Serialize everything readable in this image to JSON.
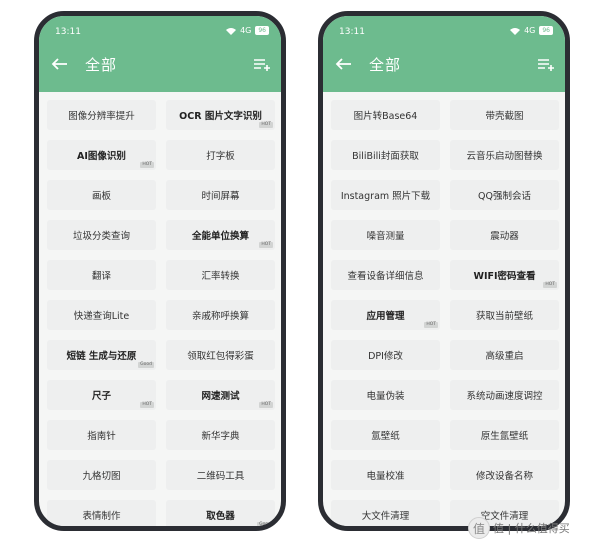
{
  "left": {
    "status": {
      "time": "13:11",
      "network": "4G",
      "battery": "96"
    },
    "title": "全部",
    "tiles": [
      {
        "label": "图像分辨率提升",
        "bold": false,
        "tag": ""
      },
      {
        "label": "OCR 图片文字识别",
        "bold": true,
        "tag": "HOT"
      },
      {
        "label": "AI图像识别",
        "bold": true,
        "tag": "HOT"
      },
      {
        "label": "打字板",
        "bold": false,
        "tag": ""
      },
      {
        "label": "画板",
        "bold": false,
        "tag": ""
      },
      {
        "label": "时间屏幕",
        "bold": false,
        "tag": ""
      },
      {
        "label": "垃圾分类查询",
        "bold": false,
        "tag": ""
      },
      {
        "label": "全能单位换算",
        "bold": true,
        "tag": "HOT"
      },
      {
        "label": "翻译",
        "bold": false,
        "tag": ""
      },
      {
        "label": "汇率转换",
        "bold": false,
        "tag": ""
      },
      {
        "label": "快递查询Lite",
        "bold": false,
        "tag": ""
      },
      {
        "label": "亲戚称呼换算",
        "bold": false,
        "tag": ""
      },
      {
        "label": "短链 生成与还原",
        "bold": true,
        "tag": "Good"
      },
      {
        "label": "领取红包得彩蛋",
        "bold": false,
        "tag": ""
      },
      {
        "label": "尺子",
        "bold": true,
        "tag": "HOT"
      },
      {
        "label": "网速测试",
        "bold": true,
        "tag": "HOT"
      },
      {
        "label": "指南针",
        "bold": false,
        "tag": ""
      },
      {
        "label": "新华字典",
        "bold": false,
        "tag": ""
      },
      {
        "label": "九格切图",
        "bold": false,
        "tag": ""
      },
      {
        "label": "二维码工具",
        "bold": false,
        "tag": ""
      },
      {
        "label": "表情制作",
        "bold": false,
        "tag": ""
      },
      {
        "label": "取色器",
        "bold": true,
        "tag": "Good"
      }
    ]
  },
  "right": {
    "status": {
      "time": "13:11",
      "network": "4G",
      "battery": "96"
    },
    "title": "全部",
    "tiles": [
      {
        "label": "图片转Base64",
        "bold": false,
        "tag": ""
      },
      {
        "label": "带壳截图",
        "bold": false,
        "tag": ""
      },
      {
        "label": "BiliBili封面获取",
        "bold": false,
        "tag": ""
      },
      {
        "label": "云音乐启动图替换",
        "bold": false,
        "tag": ""
      },
      {
        "label": "Instagram 照片下载",
        "bold": false,
        "tag": ""
      },
      {
        "label": "QQ强制会话",
        "bold": false,
        "tag": ""
      },
      {
        "label": "噪音测量",
        "bold": false,
        "tag": ""
      },
      {
        "label": "震动器",
        "bold": false,
        "tag": ""
      },
      {
        "label": "查看设备详细信息",
        "bold": false,
        "tag": ""
      },
      {
        "label": "WIFI密码查看",
        "bold": true,
        "tag": "HOT"
      },
      {
        "label": "应用管理",
        "bold": true,
        "tag": "HOT"
      },
      {
        "label": "获取当前壁纸",
        "bold": false,
        "tag": ""
      },
      {
        "label": "DPI修改",
        "bold": false,
        "tag": ""
      },
      {
        "label": "高级重启",
        "bold": false,
        "tag": ""
      },
      {
        "label": "电量伪装",
        "bold": false,
        "tag": ""
      },
      {
        "label": "系统动画速度调控",
        "bold": false,
        "tag": ""
      },
      {
        "label": "氲壁纸",
        "bold": false,
        "tag": ""
      },
      {
        "label": "原生氲壁纸",
        "bold": false,
        "tag": ""
      },
      {
        "label": "电量校准",
        "bold": false,
        "tag": ""
      },
      {
        "label": "修改设备名称",
        "bold": false,
        "tag": ""
      },
      {
        "label": "大文件清理",
        "bold": false,
        "tag": ""
      },
      {
        "label": "空文件清理",
        "bold": false,
        "tag": ""
      }
    ]
  },
  "watermark": "值 | 什么值得买",
  "colors": {
    "header": "#6dbb8e",
    "tile": "#eeefef",
    "frame": "#2b2d33"
  },
  "icons": {
    "back": "arrow-left-icon",
    "menu": "playlist-add-icon"
  }
}
